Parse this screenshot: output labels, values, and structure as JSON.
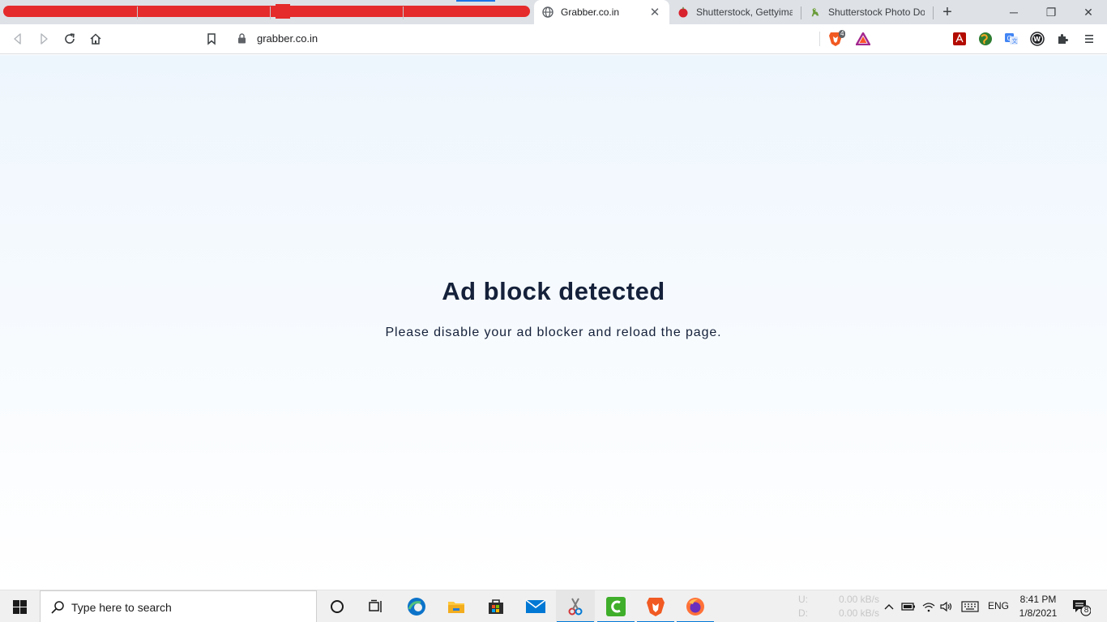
{
  "browser": {
    "tabs": [
      {
        "title": "Grabber.co.in",
        "active": true,
        "icon": "globe-icon"
      },
      {
        "title": "Shutterstock, Gettyimag",
        "active": false,
        "icon": "red-apple-icon"
      },
      {
        "title": "Shutterstock Photo Dov",
        "active": false,
        "icon": "dinosaur-icon"
      }
    ],
    "new_tab_label": "+",
    "window_controls": {
      "minimize": "─",
      "restore": "❐",
      "close": "✕"
    },
    "address": {
      "url": "grabber.co.in"
    },
    "brave_badge_count": "4"
  },
  "page": {
    "headline": "Ad block detected",
    "message": "Please disable your ad blocker and reload the page."
  },
  "taskbar": {
    "search_placeholder": "Type here to search",
    "network": {
      "upload_label": "U:",
      "upload_value": "0.00 kB/s",
      "download_label": "D:",
      "download_value": "0.00 kB/s"
    },
    "language": "ENG",
    "time": "8:41 PM",
    "date": "1/8/2021",
    "notification_count": "8"
  },
  "colors": {
    "redaction": "#e52b2b",
    "heading": "#15213a",
    "taskbar_accent": "#0078d7"
  }
}
